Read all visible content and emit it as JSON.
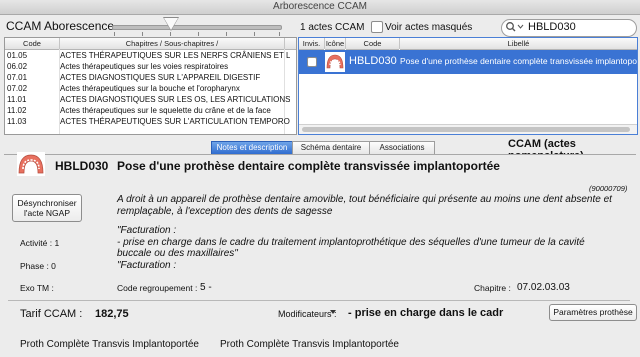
{
  "window": {
    "title": "Arborescence CCAM"
  },
  "toolbar": {
    "tree_label": "CCAM Aborescence",
    "count_label": "1 actes CCAM",
    "hidden_label": "Voir actes masqués",
    "search_value": "HBLD030"
  },
  "left_table": {
    "headers": {
      "code": "Code",
      "chapters": "Chapitres / Sous-chapitres /"
    },
    "rows": [
      {
        "code": "01.05",
        "text": "ACTES THÉRAPEUTIQUES SUR LES NERFS CRÂNIENS ET LES NERF"
      },
      {
        "code": "06.02",
        "text": "Actes thérapeutiques sur les voies respiratoires"
      },
      {
        "code": "07.01",
        "text": "ACTES DIAGNOSTIQUES SUR L'APPAREIL DIGESTIF"
      },
      {
        "code": "07.02",
        "text": "Actes thérapeutiques sur la bouche et l'oropharynx"
      },
      {
        "code": "11.01",
        "text": "ACTES DIAGNOSTIQUES SUR LES OS, LES ARTICULATIONS ET"
      },
      {
        "code": "11.02",
        "text": "Actes thérapeutiques sur le squelette du crâne et de la face"
      },
      {
        "code": "11.03",
        "text": "ACTES THÉRAPEUTIQUES SUR L'ARTICULATION TEMPOROMANDIB"
      }
    ]
  },
  "right_table": {
    "headers": {
      "invis": "Invis.",
      "icone": "Icône",
      "code": "Code",
      "libelle": "Libellé"
    },
    "row": {
      "code": "HBLD030",
      "label": "Pose d'une prothèse dentaire complète transvissée implantoportée"
    }
  },
  "tabs": [
    {
      "label": "Notes et description"
    },
    {
      "label": "Schéma dentaire"
    },
    {
      "label": "Associations"
    }
  ],
  "section_title": "CCAM (actes nomenclature)",
  "detail": {
    "code": "HBLD030",
    "title": "Pose d'une prothèse dentaire complète transvissée implantoportée",
    "ref": "(90000709)",
    "desync_line1": "Désynchroniser",
    "desync_line2": "l'acte NGAP",
    "desc_line1": "A droit à un appareil de prothèse dentaire amovible, tout bénéficiaire qui présente au moins une dent absente et",
    "desc_line2": "remplaçable, à l'exception des dents de sagesse",
    "fact_line1": "\"Facturation :",
    "fact_line2": "- prise en charge dans le cadre du traitement implantoprothétique des séquelles d'une tumeur de la cavité",
    "fact_line3": "buccale ou des maxillaires\"",
    "fact_line4": "\"Facturation :",
    "activity": "Activité : 1",
    "phase": "Phase :   0",
    "exo": "Exo TM :",
    "regroup_label": "Code regroupement :",
    "regroup_value": "5 -",
    "chapter_label": "Chapitre :",
    "chapter_value": "07.02.03.03",
    "tarif_label": "Tarif CCAM :",
    "tarif_value": "182,75",
    "modif_label": "Modificateurs :",
    "modif_value": "- prise en charge dans le cadr",
    "prosthesis_button": "Paramètres prothèse",
    "footer_left": "Proth Complète Transvis Implantoportée",
    "footer_right": "Proth Complète Transvis Implantoportée"
  }
}
